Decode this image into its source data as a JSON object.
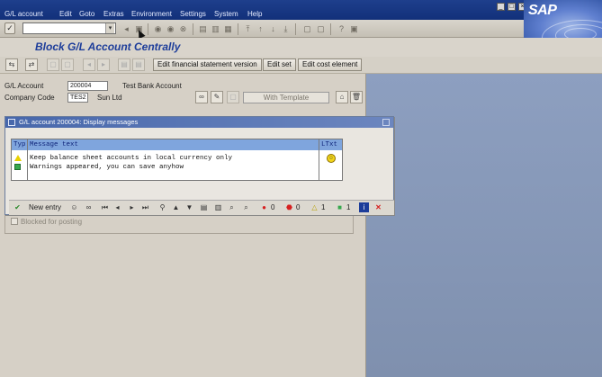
{
  "menubar": {
    "items": [
      "G/L account",
      "Edit",
      "Goto",
      "Extras",
      "Environment",
      "Settings",
      "System",
      "Help"
    ]
  },
  "sap_logo": "SAP",
  "title": "Block G/L Account Centrally",
  "app_toolbar": {
    "edit_fs_version": "Edit financial statement version",
    "edit_set": "Edit set",
    "edit_cost_element": "Edit cost element"
  },
  "form": {
    "gl_account_label": "G/L Account",
    "gl_account_value": "200004",
    "gl_account_desc": "Test Bank Account",
    "company_code_label": "Company Code",
    "company_code_value": "TES2",
    "company_name": "Sun Ltd",
    "with_template": "With Template",
    "blocked_for_posting": "Blocked for posting"
  },
  "dialog": {
    "title": "G/L account 200004: Display messages",
    "col_typ": "Typ",
    "col_message": "Message text",
    "col_ltxt": "LTxt",
    "messages": [
      {
        "type": "warning",
        "text": "Keep balance sheet accounts in local currency only"
      },
      {
        "type": "success",
        "text": "Warnings appeared, you can save anyhow"
      }
    ],
    "toolbar": {
      "new_entry": "New entry",
      "error_count": "0",
      "stop_count": "0",
      "warning_count": "1",
      "success_count": "1"
    }
  },
  "colors": {
    "menubar": "#1e3f8c",
    "title_text": "#1d3d9a",
    "dialog_header": "#7fa5dd",
    "warning": "#e9d000",
    "success": "#36a84d",
    "error": "#d62020"
  }
}
